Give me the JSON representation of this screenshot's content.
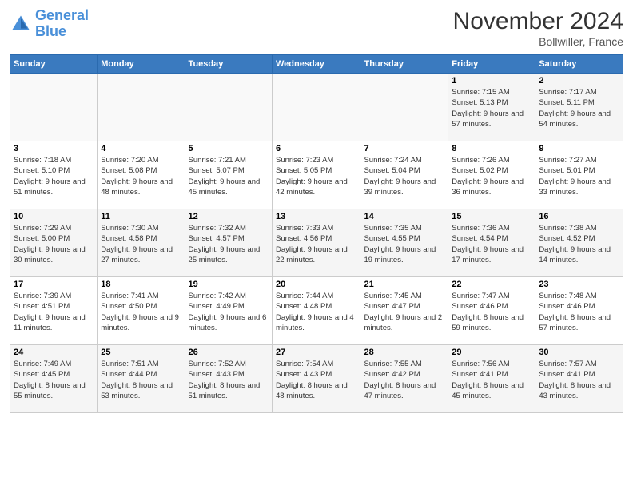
{
  "logo": {
    "line1": "General",
    "line2": "Blue"
  },
  "title": "November 2024",
  "location": "Bollwiller, France",
  "days_header": [
    "Sunday",
    "Monday",
    "Tuesday",
    "Wednesday",
    "Thursday",
    "Friday",
    "Saturday"
  ],
  "weeks": [
    [
      {
        "num": "",
        "info": ""
      },
      {
        "num": "",
        "info": ""
      },
      {
        "num": "",
        "info": ""
      },
      {
        "num": "",
        "info": ""
      },
      {
        "num": "",
        "info": ""
      },
      {
        "num": "1",
        "info": "Sunrise: 7:15 AM\nSunset: 5:13 PM\nDaylight: 9 hours and 57 minutes."
      },
      {
        "num": "2",
        "info": "Sunrise: 7:17 AM\nSunset: 5:11 PM\nDaylight: 9 hours and 54 minutes."
      }
    ],
    [
      {
        "num": "3",
        "info": "Sunrise: 7:18 AM\nSunset: 5:10 PM\nDaylight: 9 hours and 51 minutes."
      },
      {
        "num": "4",
        "info": "Sunrise: 7:20 AM\nSunset: 5:08 PM\nDaylight: 9 hours and 48 minutes."
      },
      {
        "num": "5",
        "info": "Sunrise: 7:21 AM\nSunset: 5:07 PM\nDaylight: 9 hours and 45 minutes."
      },
      {
        "num": "6",
        "info": "Sunrise: 7:23 AM\nSunset: 5:05 PM\nDaylight: 9 hours and 42 minutes."
      },
      {
        "num": "7",
        "info": "Sunrise: 7:24 AM\nSunset: 5:04 PM\nDaylight: 9 hours and 39 minutes."
      },
      {
        "num": "8",
        "info": "Sunrise: 7:26 AM\nSunset: 5:02 PM\nDaylight: 9 hours and 36 minutes."
      },
      {
        "num": "9",
        "info": "Sunrise: 7:27 AM\nSunset: 5:01 PM\nDaylight: 9 hours and 33 minutes."
      }
    ],
    [
      {
        "num": "10",
        "info": "Sunrise: 7:29 AM\nSunset: 5:00 PM\nDaylight: 9 hours and 30 minutes."
      },
      {
        "num": "11",
        "info": "Sunrise: 7:30 AM\nSunset: 4:58 PM\nDaylight: 9 hours and 27 minutes."
      },
      {
        "num": "12",
        "info": "Sunrise: 7:32 AM\nSunset: 4:57 PM\nDaylight: 9 hours and 25 minutes."
      },
      {
        "num": "13",
        "info": "Sunrise: 7:33 AM\nSunset: 4:56 PM\nDaylight: 9 hours and 22 minutes."
      },
      {
        "num": "14",
        "info": "Sunrise: 7:35 AM\nSunset: 4:55 PM\nDaylight: 9 hours and 19 minutes."
      },
      {
        "num": "15",
        "info": "Sunrise: 7:36 AM\nSunset: 4:54 PM\nDaylight: 9 hours and 17 minutes."
      },
      {
        "num": "16",
        "info": "Sunrise: 7:38 AM\nSunset: 4:52 PM\nDaylight: 9 hours and 14 minutes."
      }
    ],
    [
      {
        "num": "17",
        "info": "Sunrise: 7:39 AM\nSunset: 4:51 PM\nDaylight: 9 hours and 11 minutes."
      },
      {
        "num": "18",
        "info": "Sunrise: 7:41 AM\nSunset: 4:50 PM\nDaylight: 9 hours and 9 minutes."
      },
      {
        "num": "19",
        "info": "Sunrise: 7:42 AM\nSunset: 4:49 PM\nDaylight: 9 hours and 6 minutes."
      },
      {
        "num": "20",
        "info": "Sunrise: 7:44 AM\nSunset: 4:48 PM\nDaylight: 9 hours and 4 minutes."
      },
      {
        "num": "21",
        "info": "Sunrise: 7:45 AM\nSunset: 4:47 PM\nDaylight: 9 hours and 2 minutes."
      },
      {
        "num": "22",
        "info": "Sunrise: 7:47 AM\nSunset: 4:46 PM\nDaylight: 8 hours and 59 minutes."
      },
      {
        "num": "23",
        "info": "Sunrise: 7:48 AM\nSunset: 4:46 PM\nDaylight: 8 hours and 57 minutes."
      }
    ],
    [
      {
        "num": "24",
        "info": "Sunrise: 7:49 AM\nSunset: 4:45 PM\nDaylight: 8 hours and 55 minutes."
      },
      {
        "num": "25",
        "info": "Sunrise: 7:51 AM\nSunset: 4:44 PM\nDaylight: 8 hours and 53 minutes."
      },
      {
        "num": "26",
        "info": "Sunrise: 7:52 AM\nSunset: 4:43 PM\nDaylight: 8 hours and 51 minutes."
      },
      {
        "num": "27",
        "info": "Sunrise: 7:54 AM\nSunset: 4:43 PM\nDaylight: 8 hours and 48 minutes."
      },
      {
        "num": "28",
        "info": "Sunrise: 7:55 AM\nSunset: 4:42 PM\nDaylight: 8 hours and 47 minutes."
      },
      {
        "num": "29",
        "info": "Sunrise: 7:56 AM\nSunset: 4:41 PM\nDaylight: 8 hours and 45 minutes."
      },
      {
        "num": "30",
        "info": "Sunrise: 7:57 AM\nSunset: 4:41 PM\nDaylight: 8 hours and 43 minutes."
      }
    ]
  ]
}
